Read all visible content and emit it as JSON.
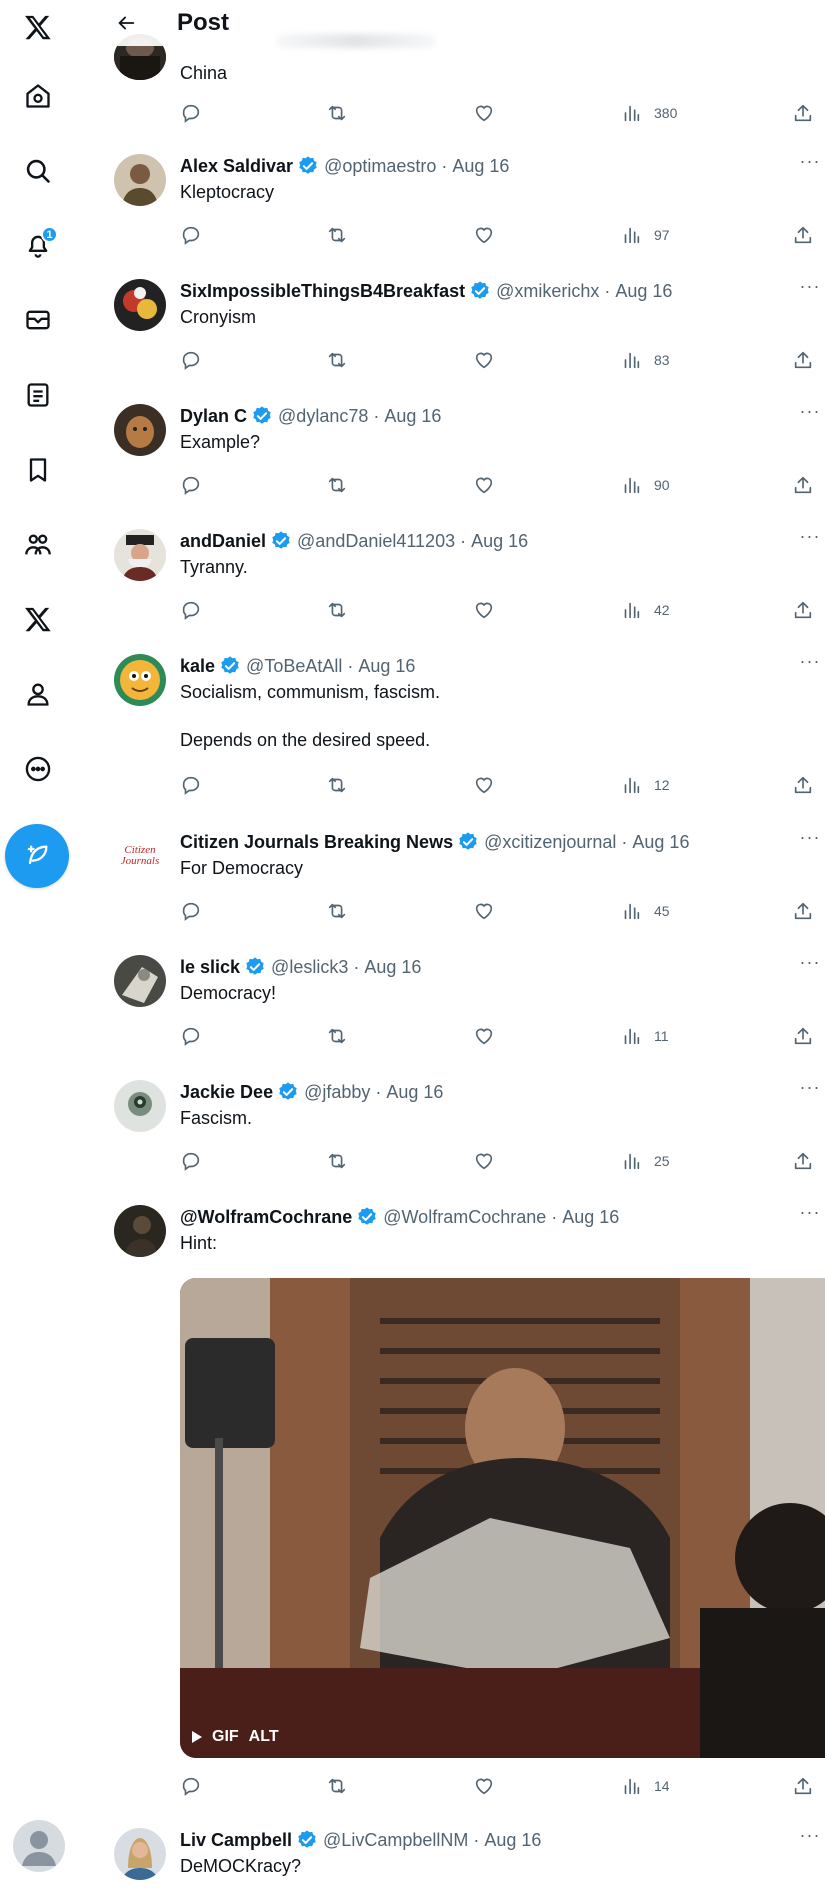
{
  "header": {
    "title": "Post"
  },
  "nav": {
    "notification_count": "1"
  },
  "colors": {
    "accent": "#1d9bf0",
    "text": "#0f1419",
    "muted": "#536471"
  },
  "tweets": [
    {
      "name": "",
      "handle": "",
      "date": "",
      "text": "China",
      "views": "380"
    },
    {
      "name": "Alex Saldivar",
      "handle": "@optimaestro",
      "date": "Aug 16",
      "text": "Kleptocracy",
      "views": "97"
    },
    {
      "name": "SixImpossibleThingsB4Breakfast",
      "handle": "@xmikerichx",
      "date": "Aug 16",
      "text": "Cronyism",
      "views": "83"
    },
    {
      "name": "Dylan C",
      "handle": "@dylanc78",
      "date": "Aug 16",
      "text": "Example?",
      "views": "90"
    },
    {
      "name": "andDaniel",
      "handle": "@andDaniel411203",
      "date": "Aug 16",
      "text": "Tyranny.",
      "views": "42"
    },
    {
      "name": "kale",
      "handle": "@ToBeAtAll",
      "date": "Aug 16",
      "text": "Socialism, communism, fascism.\n\nDepends on the desired speed.",
      "views": "12"
    },
    {
      "name": "Citizen Journals Breaking News",
      "handle": "@xcitizenjournal",
      "date": "Aug 16",
      "text": "For Democracy",
      "views": "45",
      "avatar_text": "Citizen Journals"
    },
    {
      "name": "le slick",
      "handle": "@leslick3",
      "date": "Aug 16",
      "text": "Democracy!",
      "views": "11"
    },
    {
      "name": "Jackie Dee",
      "handle": "@jfabby",
      "date": "Aug 16",
      "text": "Fascism.",
      "views": "25"
    },
    {
      "name": "@WolframCochrane",
      "handle": "@WolframCochrane",
      "date": "Aug 16",
      "text": "Hint:",
      "views": "14",
      "media": {
        "gif_label": "GIF",
        "alt_label": "ALT"
      }
    },
    {
      "name": "Liv Campbell",
      "handle": "@LivCampbellNM",
      "date": "Aug 16",
      "text": "DeMOCKracy?",
      "views": ""
    }
  ]
}
